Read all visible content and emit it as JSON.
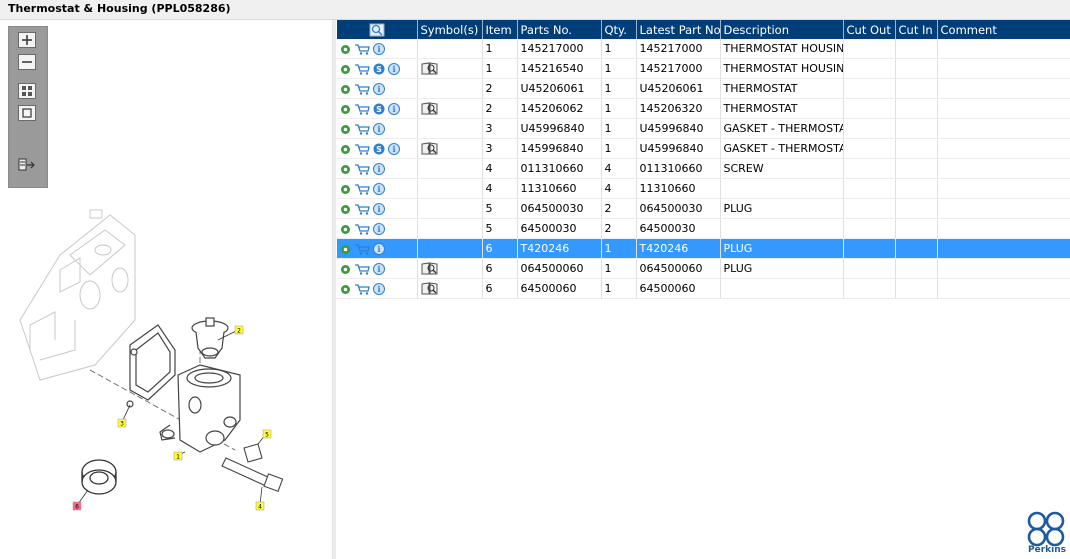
{
  "title": "Thermostat & Housing (PPL058286)",
  "toolbar": {
    "buttons": [
      "zoom-in",
      "zoom-out",
      "fit-all",
      "fit-window",
      "export"
    ]
  },
  "columns": [
    "",
    "Symbol(s)",
    "Item",
    "Parts No.",
    "Qty.",
    "Latest Part No.",
    "Description",
    "Cut Out",
    "Cut In",
    "Comment"
  ],
  "rows": [
    {
      "s": false,
      "sym": false,
      "item": "1",
      "part": "145217000",
      "qty": "1",
      "latest": "145217000",
      "desc": "THERMOSTAT HOUSING"
    },
    {
      "s": true,
      "sym": true,
      "item": "1",
      "part": "145216540",
      "qty": "1",
      "latest": "145217000",
      "desc": "THERMOSTAT HOUSING"
    },
    {
      "s": false,
      "sym": false,
      "item": "2",
      "part": "U45206061",
      "qty": "1",
      "latest": "U45206061",
      "desc": "THERMOSTAT"
    },
    {
      "s": true,
      "sym": true,
      "item": "2",
      "part": "145206062",
      "qty": "1",
      "latest": "145206320",
      "desc": "THERMOSTAT"
    },
    {
      "s": false,
      "sym": false,
      "item": "3",
      "part": "U45996840",
      "qty": "1",
      "latest": "U45996840",
      "desc": "GASKET - THERMOSTAT"
    },
    {
      "s": true,
      "sym": true,
      "item": "3",
      "part": "145996840",
      "qty": "1",
      "latest": "U45996840",
      "desc": "GASKET - THERMOSTAT"
    },
    {
      "s": false,
      "sym": false,
      "item": "4",
      "part": "011310660",
      "qty": "4",
      "latest": "011310660",
      "desc": "SCREW"
    },
    {
      "s": false,
      "sym": false,
      "item": "4",
      "part": "11310660",
      "qty": "4",
      "latest": "11310660",
      "desc": ""
    },
    {
      "s": false,
      "sym": false,
      "item": "5",
      "part": "064500030",
      "qty": "2",
      "latest": "064500030",
      "desc": "PLUG"
    },
    {
      "s": false,
      "sym": false,
      "item": "5",
      "part": "64500030",
      "qty": "2",
      "latest": "64500030",
      "desc": ""
    },
    {
      "s": false,
      "sym": false,
      "item": "6",
      "part": "T420246",
      "qty": "1",
      "latest": "T420246",
      "desc": "PLUG",
      "selected": true
    },
    {
      "s": false,
      "sym": true,
      "item": "6",
      "part": "064500060",
      "qty": "1",
      "latest": "064500060",
      "desc": "PLUG"
    },
    {
      "s": false,
      "sym": true,
      "item": "6",
      "part": "64500060",
      "qty": "1",
      "latest": "64500060",
      "desc": ""
    }
  ],
  "diagram_callouts": [
    "1",
    "2",
    "3",
    "4",
    "5",
    "6"
  ],
  "logo_text": "Perkins",
  "colors": {
    "header": "#003e7a",
    "selected": "#3399ff",
    "icon_blue": "#2f7fd0",
    "icon_green": "#3a9a3a",
    "callout": "#ffff33"
  }
}
